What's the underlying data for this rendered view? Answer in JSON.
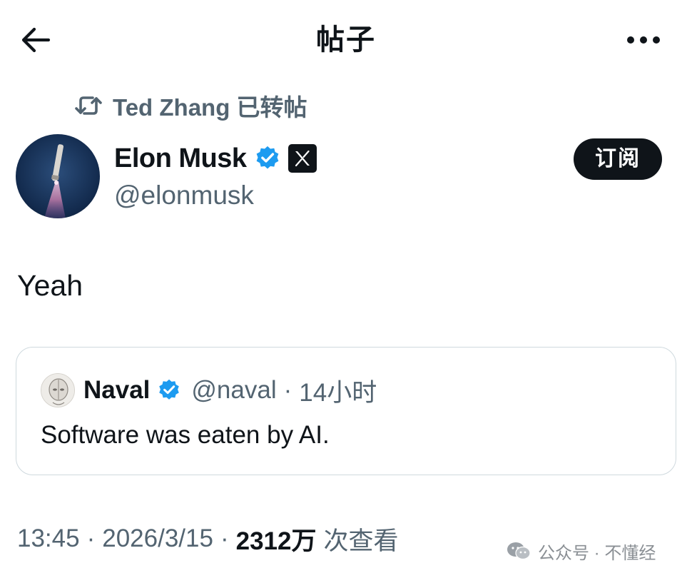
{
  "header": {
    "title": "帖子",
    "back_icon": "arrow-left-icon",
    "more_icon": "more-horizontal-icon"
  },
  "retweet": {
    "text": "Ted Zhang 已转帖",
    "icon": "retweet-icon"
  },
  "author": {
    "name": "Elon Musk",
    "handle": "@elonmusk",
    "verified_color": "#1d9bf0",
    "badge_icon": "x-logo-icon",
    "subscribe_label": "订阅"
  },
  "tweet": {
    "text": "Yeah"
  },
  "quote": {
    "name": "Naval",
    "handle": "@naval",
    "separator": "·",
    "time": "14小时",
    "text": "Software was eaten by AI."
  },
  "meta": {
    "time": "13:45",
    "separator": "·",
    "date": "2026/3/15",
    "views_count": "2312万",
    "views_label": "次查看"
  },
  "watermark": {
    "text": "公众号 · 不懂经"
  },
  "colors": {
    "text_primary": "#0f1419",
    "text_secondary": "#536471",
    "verified": "#1d9bf0",
    "border": "#cfd9de"
  }
}
